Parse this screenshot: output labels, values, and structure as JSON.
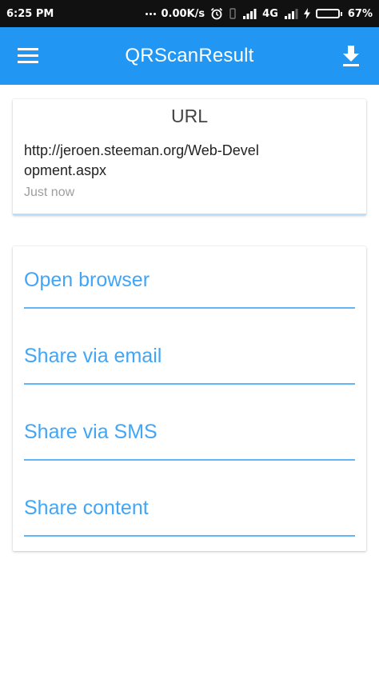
{
  "status_bar": {
    "time": "6:25 PM",
    "speed": "0.00K/s",
    "network": "4G",
    "battery": "67%",
    "battery_level": 0.67
  },
  "app_bar": {
    "title": "QRScanResult",
    "menu_icon": "hamburger-menu-icon",
    "download_icon": "download-icon"
  },
  "result": {
    "type": "URL",
    "text": "http://jeroen.steeman.org/Web-Development.aspx",
    "time": "Just now"
  },
  "actions": [
    {
      "label": "Open browser"
    },
    {
      "label": "Share via email"
    },
    {
      "label": "Share via SMS"
    },
    {
      "label": "Share content"
    }
  ],
  "colors": {
    "primary": "#2196f3",
    "accent_text": "#42a5f5",
    "underline": "#64b5f6"
  }
}
